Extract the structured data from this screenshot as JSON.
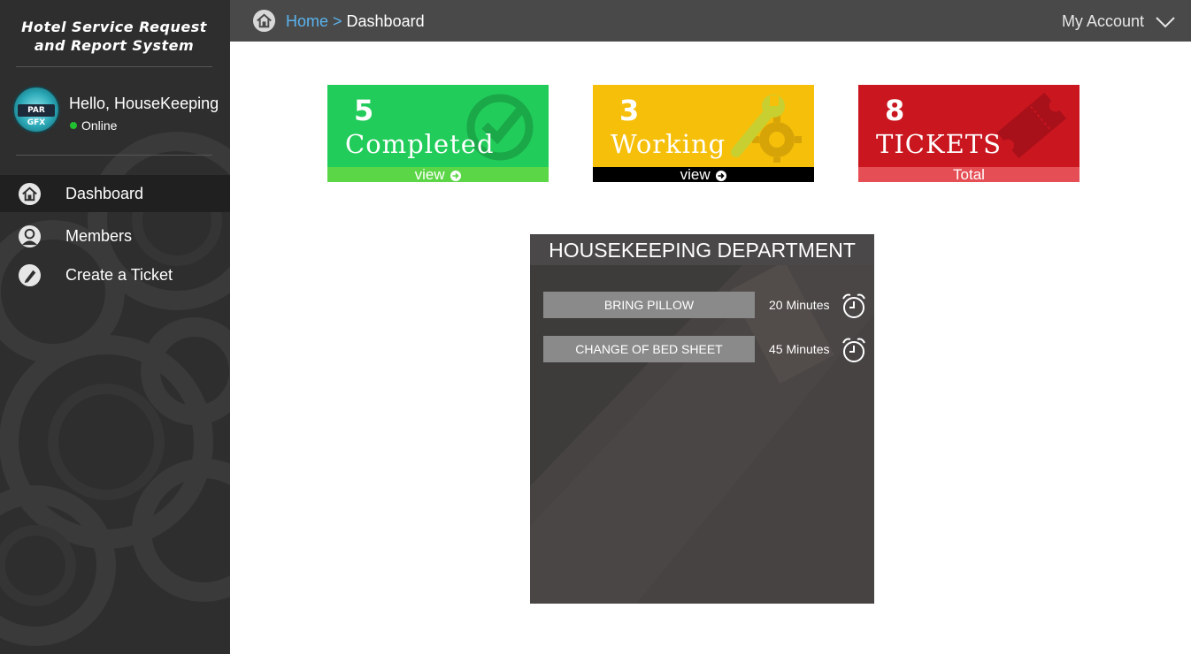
{
  "brand": {
    "line1": "Hotel Service Request",
    "line2": "and Report System"
  },
  "user": {
    "avatar_text": "PAR GFX",
    "greeting": "Hello, HouseKeeping",
    "status": "Online",
    "status_color": "#20c030"
  },
  "nav": {
    "items": [
      {
        "label": "Dashboard",
        "icon": "home-icon",
        "active": true
      },
      {
        "label": "Members",
        "icon": "user-icon",
        "active": false
      },
      {
        "label": "Create a Ticket",
        "icon": "pen-icon",
        "active": false
      }
    ]
  },
  "topbar": {
    "home_link": "Home",
    "separator": " > ",
    "current": "Dashboard",
    "account": "My Account"
  },
  "cards": [
    {
      "count": "5",
      "label": "Completed",
      "footer": "view",
      "color": "#22cc5a",
      "icon": "check-circle-icon"
    },
    {
      "count": "3",
      "label": "Working",
      "footer": "view",
      "color": "#f5bf0a",
      "icon": "wrench-gear-icon"
    },
    {
      "count": "8",
      "label": "TICKETS",
      "footer": "Total",
      "color": "#c9161f",
      "icon": "ticket-icon"
    }
  ],
  "department": {
    "title": "HOUSEKEEPING DEPARTMENT",
    "requests": [
      {
        "name": "BRING PILLOW",
        "duration": "20 Minutes",
        "icon": "alarm-clock-icon"
      },
      {
        "name": "CHANGE OF BED SHEET",
        "duration": "45 Minutes",
        "icon": "alarm-clock-icon"
      }
    ]
  }
}
